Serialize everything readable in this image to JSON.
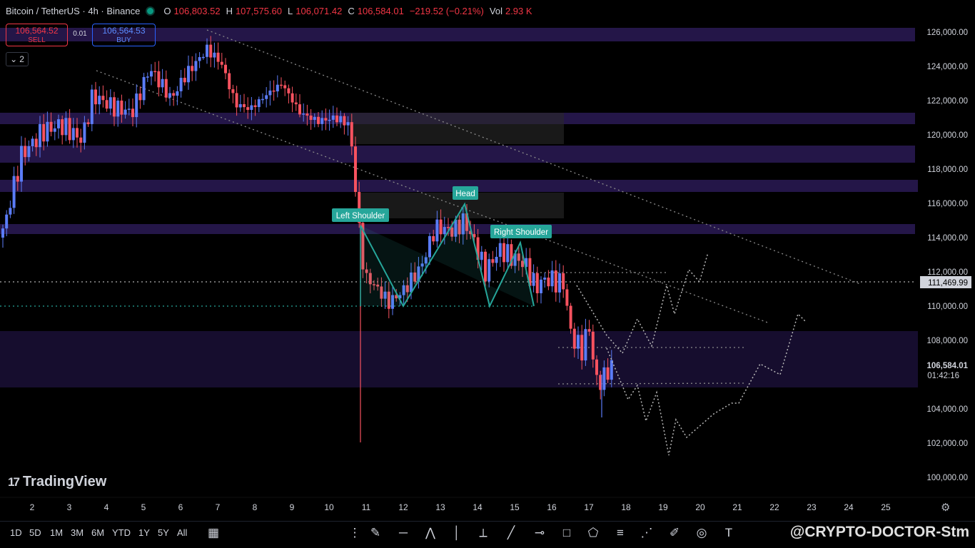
{
  "header": {
    "symbol": "Bitcoin / TetherUS · 4h · Binance",
    "open_label": "O",
    "open": "106,803.52",
    "high_label": "H",
    "high": "107,575.60",
    "low_label": "L",
    "low": "106,071.42",
    "close_label": "C",
    "close": "106,584.01",
    "change": "−219.52 (−0.21%)",
    "vol_label": "Vol",
    "vol": "2.93 K"
  },
  "trade": {
    "sell_price": "106,564.52",
    "sell_label": "SELL",
    "spread": "0.01",
    "buy_price": "106,564.53",
    "buy_label": "BUY"
  },
  "indicator_toggle": {
    "count": "2"
  },
  "chart_data": {
    "type": "candlestick",
    "y_range": [
      98500,
      127500
    ],
    "y_ticks": [
      "126,000.00",
      "124,000.00",
      "122,000.00",
      "120,000.00",
      "118,000.00",
      "116,000.00",
      "114,000.00",
      "112,000.00",
      "110,000.00",
      "108,000.00",
      "104,000.00",
      "102,000.00",
      "100,000.00"
    ],
    "x_ticks": [
      "2",
      "3",
      "4",
      "5",
      "6",
      "7",
      "8",
      "9",
      "10",
      "11",
      "12",
      "13",
      "14",
      "15",
      "16",
      "17",
      "18",
      "19",
      "20",
      "21",
      "22",
      "23",
      "24",
      "25"
    ],
    "price_label": "111,469.99",
    "last_price": "106,584.01",
    "countdown": "01:42:16",
    "annotations": [
      {
        "text": "Left Shoulder"
      },
      {
        "text": "Head"
      },
      {
        "text": "Right Shoulder"
      }
    ]
  },
  "branding": {
    "logo": "TradingView"
  },
  "toolbar": {
    "timeframes": [
      "1D",
      "5D",
      "1M",
      "3M",
      "6M",
      "YTD",
      "1Y",
      "5Y",
      "All"
    ],
    "tools": [
      "calendar-icon",
      "grip-icon",
      "brush-icon",
      "horizontal-line-icon",
      "pattern-icon",
      "vertical-line-icon",
      "cross-line-icon",
      "trend-line-icon",
      "ray-icon",
      "rectangle-icon",
      "polygon-icon",
      "fib-icon",
      "path-icon",
      "pen-icon",
      "circle-icon",
      "text-icon"
    ]
  },
  "watermark": {
    "text": "@CRYPTO-DOCTOR-Stm"
  },
  "colors": {
    "bull": "#5b7cf7",
    "bear": "#f7525f",
    "zone": "#2a1a55",
    "pattern": "#26a69a",
    "bg": "#000000"
  }
}
